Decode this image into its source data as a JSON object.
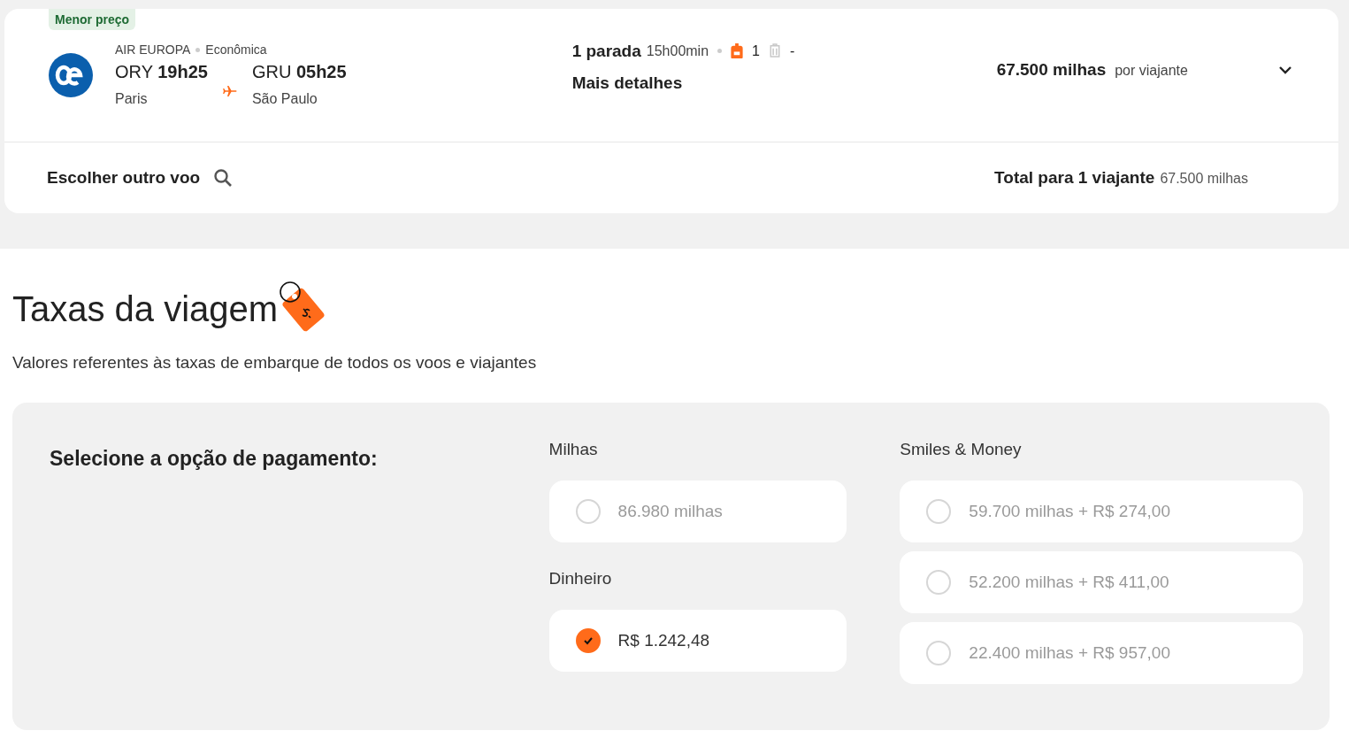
{
  "flight": {
    "badge": "Menor preço",
    "airline": "AIR EUROPA",
    "cabin": "Econômica",
    "origin": {
      "code": "ORY",
      "time": "19h25",
      "city": "Paris"
    },
    "destination": {
      "code": "GRU",
      "time": "05h25",
      "city": "São Paulo"
    },
    "stops": "1 parada",
    "duration": "15h00min",
    "carry_on": "1",
    "checked_bag": "-",
    "details_link": "Mais detalhes",
    "price": "67.500 milhas",
    "price_unit": "por viajante",
    "expanded": false
  },
  "footer": {
    "change_flight": "Escolher outro voo",
    "total_label": "Total para 1 viajante",
    "total_value": "67.500 milhas"
  },
  "fees": {
    "title": "Taxas da viagem",
    "subtitle": "Valores referentes às taxas de embarque de todos os voos e viajantes",
    "prompt": "Selecione a opção de pagamento:",
    "columns": [
      [
        {
          "label": "Milhas",
          "options": [
            {
              "text": "86.980 milhas",
              "selected": false,
              "disabled": true
            }
          ]
        },
        {
          "label": "Dinheiro",
          "options": [
            {
              "text": "R$ 1.242,48",
              "selected": true,
              "disabled": false
            }
          ]
        }
      ],
      [
        {
          "label": "Smiles & Money",
          "options": [
            {
              "text": "59.700 milhas + R$ 274,00",
              "selected": false,
              "disabled": true
            },
            {
              "text": "52.200 milhas + R$ 411,00",
              "selected": false,
              "disabled": true
            },
            {
              "text": "22.400 milhas + R$ 957,00",
              "selected": false,
              "disabled": true
            }
          ]
        }
      ]
    ]
  }
}
